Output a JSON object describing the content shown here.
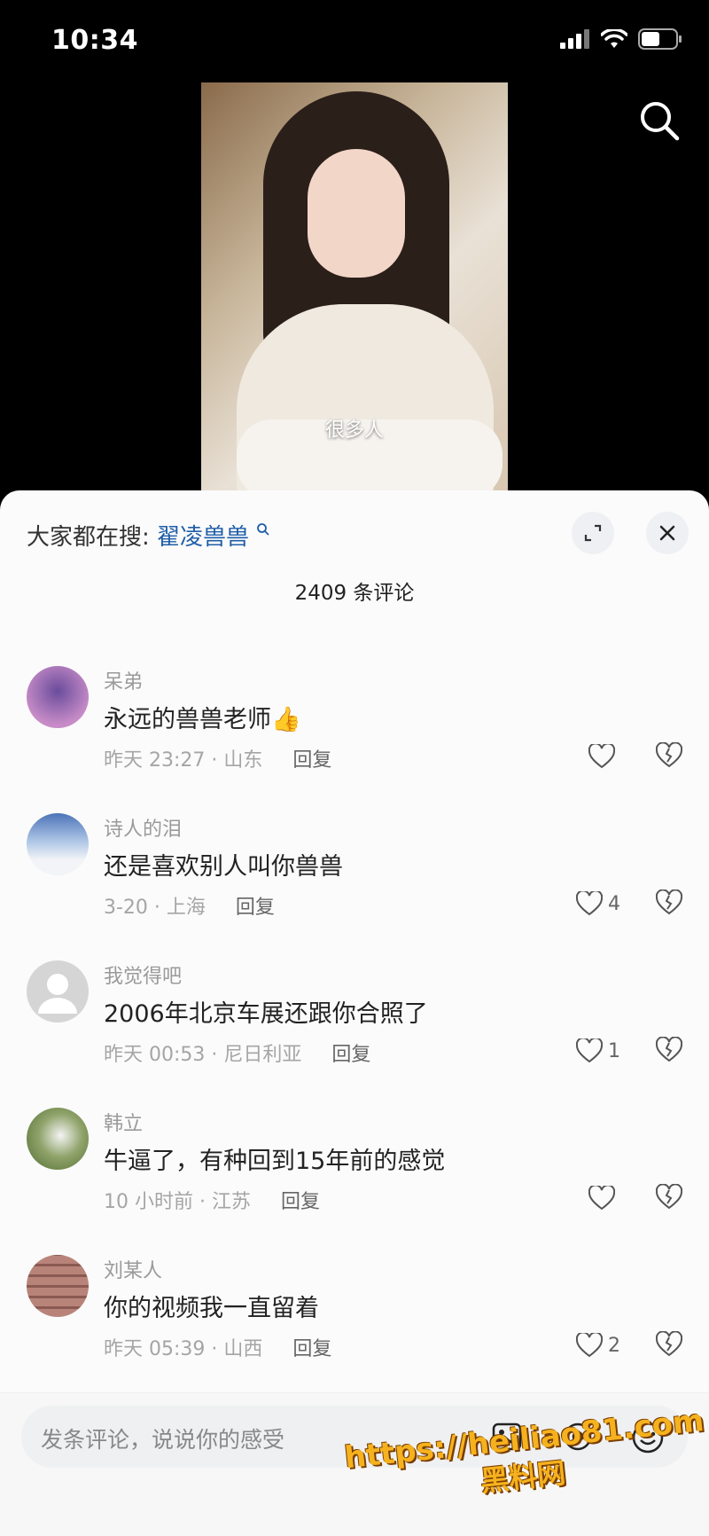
{
  "status_bar": {
    "time": "10:34"
  },
  "video": {
    "subtitle": "很多人"
  },
  "sheet": {
    "hot_prefix": "大家都在搜:",
    "hot_keyword": "翟凌兽兽",
    "comment_count": "2409 条评论"
  },
  "comments": [
    {
      "user": "呆弟",
      "text": "永远的兽兽老师👍",
      "time_loc": "昨天 23:27 · 山东",
      "reply": "回复",
      "likes": ""
    },
    {
      "user": "诗人的泪",
      "text": "还是喜欢别人叫你兽兽",
      "time_loc": "3-20 · 上海",
      "reply": "回复",
      "likes": "4"
    },
    {
      "user": "我觉得吧",
      "text": "2006年北京车展还跟你合照了",
      "time_loc": "昨天 00:53 · 尼日利亚",
      "reply": "回复",
      "likes": "1"
    },
    {
      "user": "韩立",
      "text": "牛逼了，有种回到15年前的感觉",
      "time_loc": "10 小时前 · 江苏",
      "reply": "回复",
      "likes": ""
    },
    {
      "user": "刘某人",
      "text": "你的视频我一直留着",
      "time_loc": "昨天 05:39 · 山西",
      "reply": "回复",
      "likes": "2"
    }
  ],
  "input": {
    "placeholder": "发条评论，说说你的感受"
  },
  "watermark": {
    "url": "https://heiliao81.com",
    "name": "黑料网"
  }
}
